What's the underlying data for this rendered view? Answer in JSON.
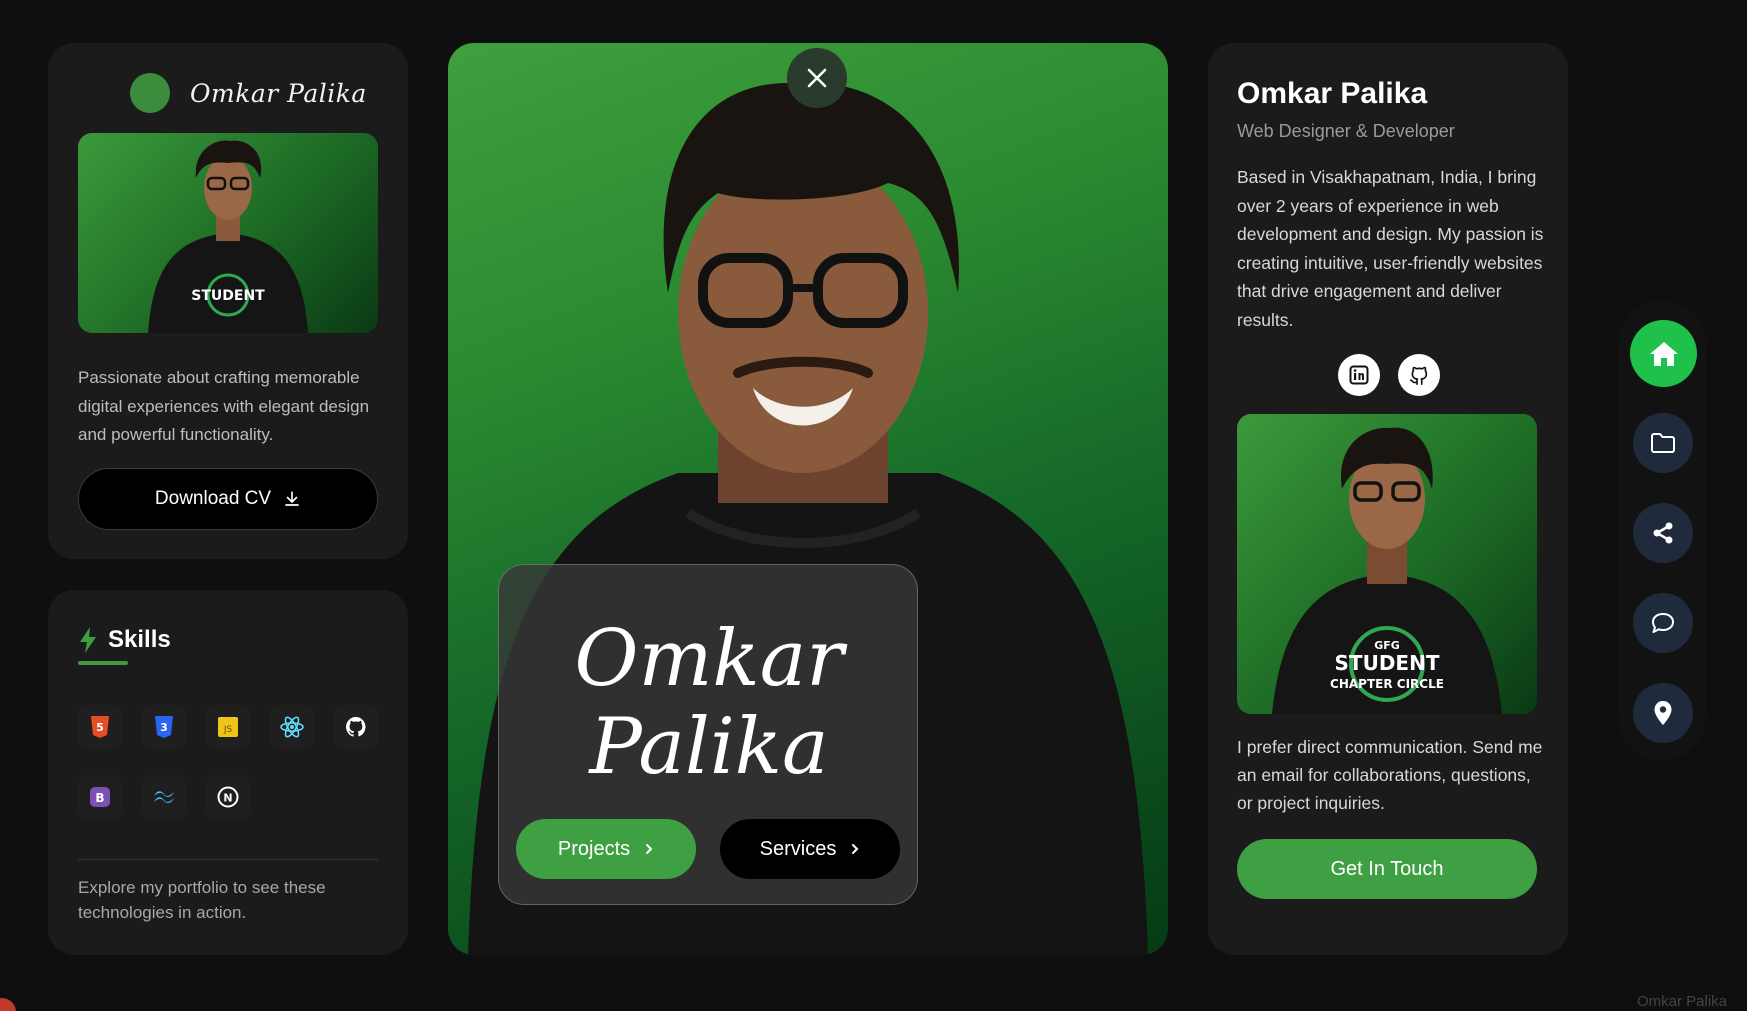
{
  "brand": {
    "name": "Omkar Palika",
    "accent": "#3d8c3d"
  },
  "profile": {
    "description": "Passionate about crafting memorable digital experiences with elegant design and powerful functionality.",
    "download_label": "Download CV"
  },
  "skills": {
    "title": "Skills",
    "items": [
      {
        "name": "html5-icon",
        "color": "#e44d26",
        "label": "5"
      },
      {
        "name": "css3-icon",
        "color": "#2965f1",
        "label": "3"
      },
      {
        "name": "javascript-icon",
        "color": "#f0c419",
        "label": "JS"
      },
      {
        "name": "react-icon",
        "color": "#61dafb",
        "label": "⚛"
      },
      {
        "name": "github-icon",
        "color": "#ffffff",
        "label": ""
      },
      {
        "name": "bootstrap-icon",
        "color": "#7952b3",
        "label": "B"
      },
      {
        "name": "tailwind-icon",
        "color": "#38bdf8",
        "label": "≈"
      },
      {
        "name": "nextjs-icon",
        "color": "#ffffff",
        "label": "N"
      }
    ],
    "note": "Explore my portfolio to see these technologies in action."
  },
  "hero": {
    "name_line1": "Omkar",
    "name_line2": "Palika",
    "projects_label": "Projects",
    "services_label": "Services"
  },
  "bio": {
    "name": "Omkar Palika",
    "role": "Web Designer & Developer",
    "text": "Based in Visakhapatnam, India, I bring over 2 years of experience in web development and design. My passion is creating intuitive, user-friendly websites that drive engagement and deliver results.",
    "contact_text": "I prefer direct communication. Send me an email for collaborations, questions, or project inquiries.",
    "touch_label": "Get In Touch"
  },
  "nav": {
    "items": [
      "home-icon",
      "folder-icon",
      "share-icon",
      "chat-icon",
      "location-icon"
    ],
    "active": "home-icon",
    "active_color": "#1fc14a"
  },
  "footer": {
    "name": "Omkar Palika"
  }
}
